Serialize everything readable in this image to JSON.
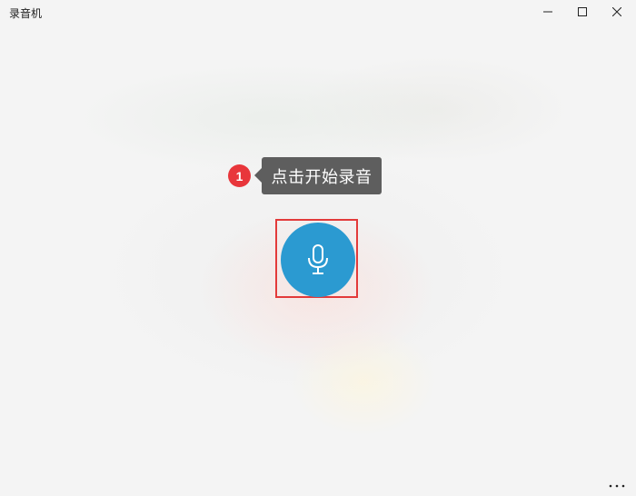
{
  "window": {
    "title": "录音机",
    "controls": {
      "minimize_icon": "minimize-icon",
      "maximize_icon": "maximize-icon",
      "close_icon": "close-icon"
    }
  },
  "annotation": {
    "step_number": "1",
    "tooltip_text": "点击开始录音",
    "badge_color": "#e8363b",
    "tooltip_color": "#5e5e5e",
    "highlight_color": "#e33a3a"
  },
  "record_button": {
    "icon": "microphone-icon",
    "color": "#2b9ad1"
  },
  "more_menu": {
    "icon": "more-dots-icon"
  }
}
